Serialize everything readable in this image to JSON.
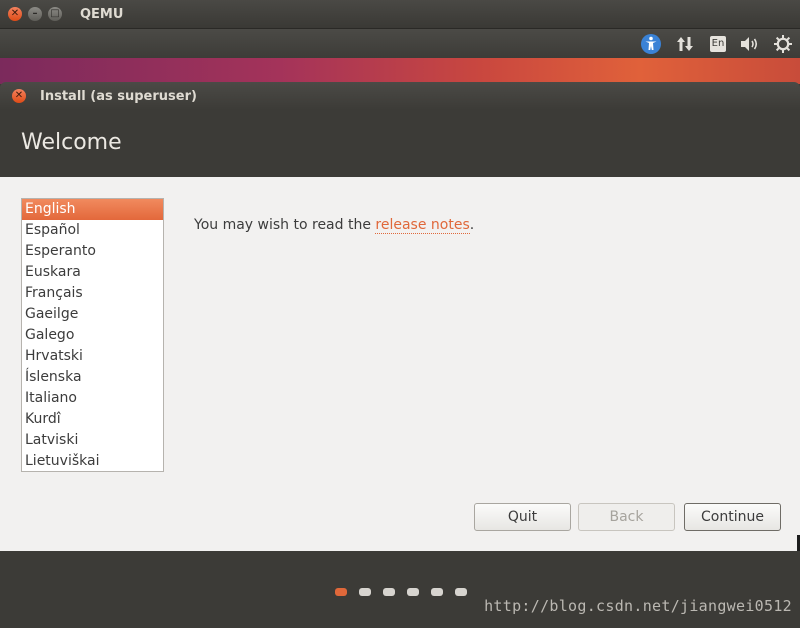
{
  "qemu": {
    "title": "QEMU",
    "close_icon": "✕",
    "minimize_icon": "–",
    "maximize_icon": "□"
  },
  "panel": {
    "language_indicator": "En"
  },
  "installer": {
    "window_title": "Install (as superuser)",
    "heading": "Welcome",
    "languages": [
      "English",
      "Español",
      "Esperanto",
      "Euskara",
      "Français",
      "Gaeilge",
      "Galego",
      "Hrvatski",
      "Íslenska",
      "Italiano",
      "Kurdî",
      "Latviski",
      "Lietuviškai"
    ],
    "selected_language": "English",
    "release_prefix": "You may wish to read the ",
    "release_link": "release notes",
    "release_suffix": ".",
    "buttons": {
      "quit": "Quit",
      "back": "Back",
      "continue": "Continue"
    },
    "progress": {
      "total_steps": 6,
      "current_step": 1
    }
  },
  "watermark": "http://blog.csdn.net/jiangwei0512",
  "colors": {
    "accent": "#e0683a",
    "selection": "#e3683b",
    "dark_chrome": "#3c3b37",
    "body_bg": "#f2f1f0"
  }
}
